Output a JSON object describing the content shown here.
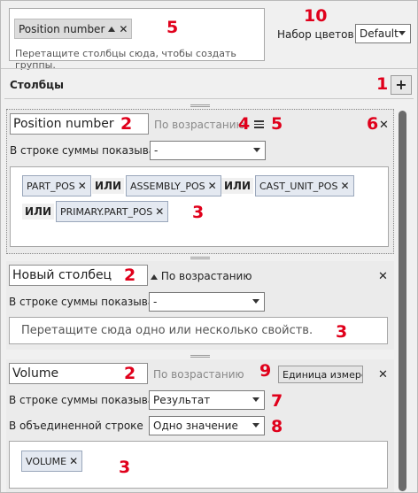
{
  "group_area": {
    "chip_label": "Position number",
    "hint": "Перетащите столбцы сюда, чтобы создать группы."
  },
  "color_set": {
    "label": "Набор цветов:",
    "value": "Default"
  },
  "columns_header": {
    "title": "Столбцы",
    "add_label": "+"
  },
  "panels": [
    {
      "name": "Position number",
      "sort": "По возрастанию",
      "sum_label": "В строке суммы показывать",
      "sum_value": "-",
      "props": [
        "PART_POS",
        "ASSEMBLY_POS",
        "CAST_UNIT_POS",
        "PRIMARY.PART_POS"
      ],
      "or_label": "ИЛИ"
    },
    {
      "name": "Новый столбец",
      "sort": "По возрастанию",
      "sum_label": "В строке суммы показывать",
      "sum_value": "-",
      "drop_hint": "Перетащите сюда одно или несколько свойств."
    },
    {
      "name": "Volume",
      "sort": "По возрастанию",
      "unit_label": "Единица измерения",
      "sum_label": "В строке суммы показывать",
      "sum_value": "Результат",
      "merged_label": "В объединенной строке показывать",
      "merged_value": "Одно значение",
      "props": [
        "VOLUME"
      ]
    }
  ],
  "annotations": {
    "n1": "1",
    "n2": "2",
    "n3": "3",
    "n4": "4",
    "n5": "5",
    "n6": "6",
    "n7": "7",
    "n8": "8",
    "n9": "9",
    "n10": "10"
  },
  "colors": {
    "annotation": "#e0001b",
    "chip_bg": "#e4e9f1",
    "panel_bg": "#ebebeb"
  }
}
